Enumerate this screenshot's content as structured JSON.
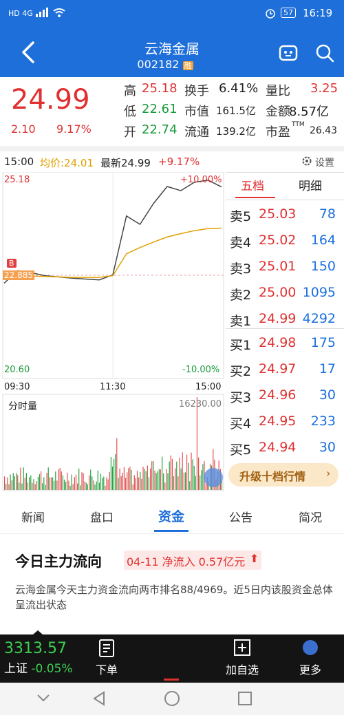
{
  "status_bar": {
    "left": "HD 4G",
    "battery": "57",
    "time": "16:19"
  },
  "header": {
    "title": "云海金属",
    "code": "002182",
    "badge": "融"
  },
  "quote": {
    "price": "24.99",
    "change": "2.10",
    "change_pct": "9.17%",
    "high_label": "高",
    "high": "25.18",
    "low_label": "低",
    "low": "22.61",
    "open_label": "开",
    "open": "22.74",
    "turnover_label": "换手",
    "turnover": "6.41%",
    "mktcap_label": "市值",
    "mktcap": "161.5亿",
    "float_label": "流通",
    "float": "139.2亿",
    "volratio_label": "量比",
    "volratio": "3.25",
    "amount_label": "金额",
    "amount": "8.57亿",
    "pe_label": "市盈",
    "pe_sup": "TTM",
    "pe": "26.43"
  },
  "chart_bar": {
    "time": "15:00",
    "avg": "均价:24.01",
    "latest": "最新24.99",
    "pct": "+9.17%",
    "settings": "设置"
  },
  "chart": {
    "y_top": "25.18",
    "y_top_pct": "+10.00%",
    "y_bottom": "20.60",
    "y_bottom_pct": "-10.00%",
    "ref_price": "22.885",
    "b_marker": "B",
    "t_start": "09:30",
    "t_mid": "11:30",
    "t_end": "15:00",
    "vol_label": "分时量",
    "vol_max": "16230.00"
  },
  "chart_data": {
    "type": "line",
    "x": [
      "09:30",
      "09:45",
      "10:00",
      "10:15",
      "10:30",
      "10:45",
      "11:00",
      "11:15",
      "11:30",
      "13:15",
      "13:30",
      "13:45",
      "14:00",
      "14:15",
      "14:30",
      "14:45",
      "15:00"
    ],
    "series": [
      {
        "name": "最新",
        "values": [
          22.7,
          23.0,
          22.95,
          22.88,
          22.85,
          22.82,
          22.8,
          22.78,
          22.9,
          24.3,
          24.1,
          24.6,
          25.0,
          24.9,
          25.1,
          25.15,
          24.99
        ]
      },
      {
        "name": "均价",
        "values": [
          22.9,
          22.88,
          22.87,
          22.86,
          22.85,
          22.84,
          22.84,
          22.84,
          22.88,
          23.4,
          23.55,
          23.68,
          23.8,
          23.88,
          23.95,
          24.0,
          24.01
        ]
      }
    ],
    "ylim": [
      20.6,
      25.18
    ]
  },
  "orderbook": {
    "tab_active": "五档",
    "tab_other": "明细",
    "asks": [
      {
        "label": "卖5",
        "price": "25.03",
        "vol": "78"
      },
      {
        "label": "卖4",
        "price": "25.02",
        "vol": "164"
      },
      {
        "label": "卖3",
        "price": "25.01",
        "vol": "150"
      },
      {
        "label": "卖2",
        "price": "25.00",
        "vol": "1095"
      },
      {
        "label": "卖1",
        "price": "24.99",
        "vol": "4292"
      }
    ],
    "bids": [
      {
        "label": "买1",
        "price": "24.98",
        "vol": "175"
      },
      {
        "label": "买2",
        "price": "24.97",
        "vol": "17"
      },
      {
        "label": "买3",
        "price": "24.96",
        "vol": "30"
      },
      {
        "label": "买4",
        "price": "24.95",
        "vol": "233"
      },
      {
        "label": "买5",
        "price": "24.94",
        "vol": "30"
      }
    ],
    "upgrade": "升级十档行情"
  },
  "tabs": [
    "新闻",
    "盘口",
    "资金",
    "公告",
    "简况"
  ],
  "funds": {
    "title": "今日主力流向",
    "badge": "04-11 净流入 0.57亿元",
    "desc": "云海金属今天主力资金流向两市排名88/4969。近5日内该股资金总体呈流出状态"
  },
  "bottom": {
    "index_value": "3313.57",
    "index_name": "上证",
    "index_pct": "-0.05%",
    "order": "下单",
    "add": "加自选",
    "more": "更多"
  }
}
